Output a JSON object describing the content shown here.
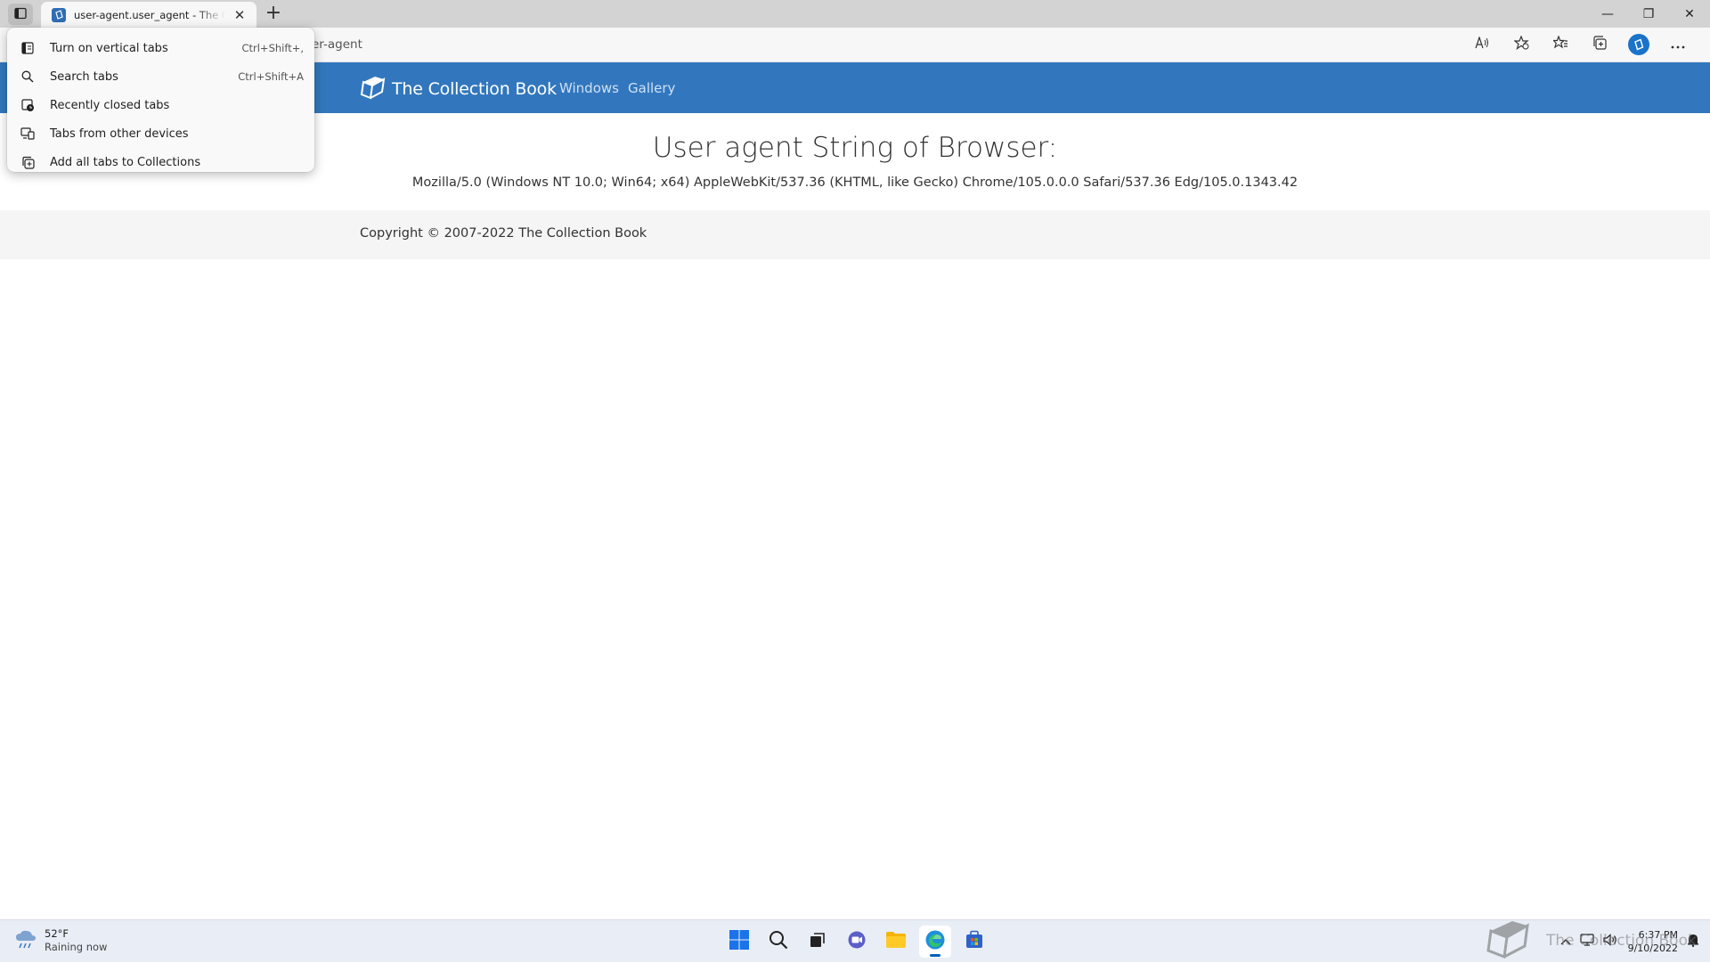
{
  "browser": {
    "tab_title": "user-agent.user_agent - The Collection Book",
    "new_tab_glyph": "+",
    "close_glyph": "✕",
    "address_fragment": "er-agent",
    "window_controls": [
      "—",
      "❐",
      "✕"
    ],
    "toolbar_icon_names": [
      "read-aloud-icon",
      "add-favorite-icon",
      "favorites-icon",
      "collections-icon",
      "profile-icon",
      "more-icon"
    ]
  },
  "tab_menu": {
    "items": [
      {
        "label": "Turn on vertical tabs",
        "shortcut": "Ctrl+Shift+,",
        "icon": "vertical-tabs-icon"
      },
      {
        "label": "Search tabs",
        "shortcut": "Ctrl+Shift+A",
        "icon": "search-icon"
      },
      {
        "label": "Recently closed tabs",
        "shortcut": "",
        "icon": "recently-closed-icon"
      },
      {
        "label": "Tabs from other devices",
        "shortcut": "",
        "icon": "devices-icon"
      },
      {
        "label": "Add all tabs to Collections",
        "shortcut": "",
        "icon": "collections-icon"
      }
    ]
  },
  "site": {
    "brand": "The Collection Book",
    "nav": [
      "Windows",
      "Gallery"
    ],
    "heading": "User agent String of Browser:",
    "user_agent": "Mozilla/5.0 (Windows NT 10.0; Win64; x64) AppleWebKit/537.36 (KHTML, like Gecko) Chrome/105.0.0.0 Safari/537.36 Edg/105.0.1343.42",
    "copyright": "Copyright © 2007-2022 The Collection Book"
  },
  "taskbar": {
    "weather_temp": "52°F",
    "weather_cond": "Raining now",
    "apps": [
      "start-icon",
      "search-icon",
      "task-view-icon",
      "chat-icon",
      "file-explorer-icon",
      "edge-icon",
      "store-icon"
    ],
    "time": "6:37 PM",
    "date": "9/10/2022",
    "watermark": "The Collection Book"
  },
  "colors": {
    "accent": "#3277bd",
    "tab_strip": "#d3d3d3",
    "toolbar": "#f7f7f7",
    "footer": "#f5f5f5",
    "taskbar": "#e9eef6"
  }
}
